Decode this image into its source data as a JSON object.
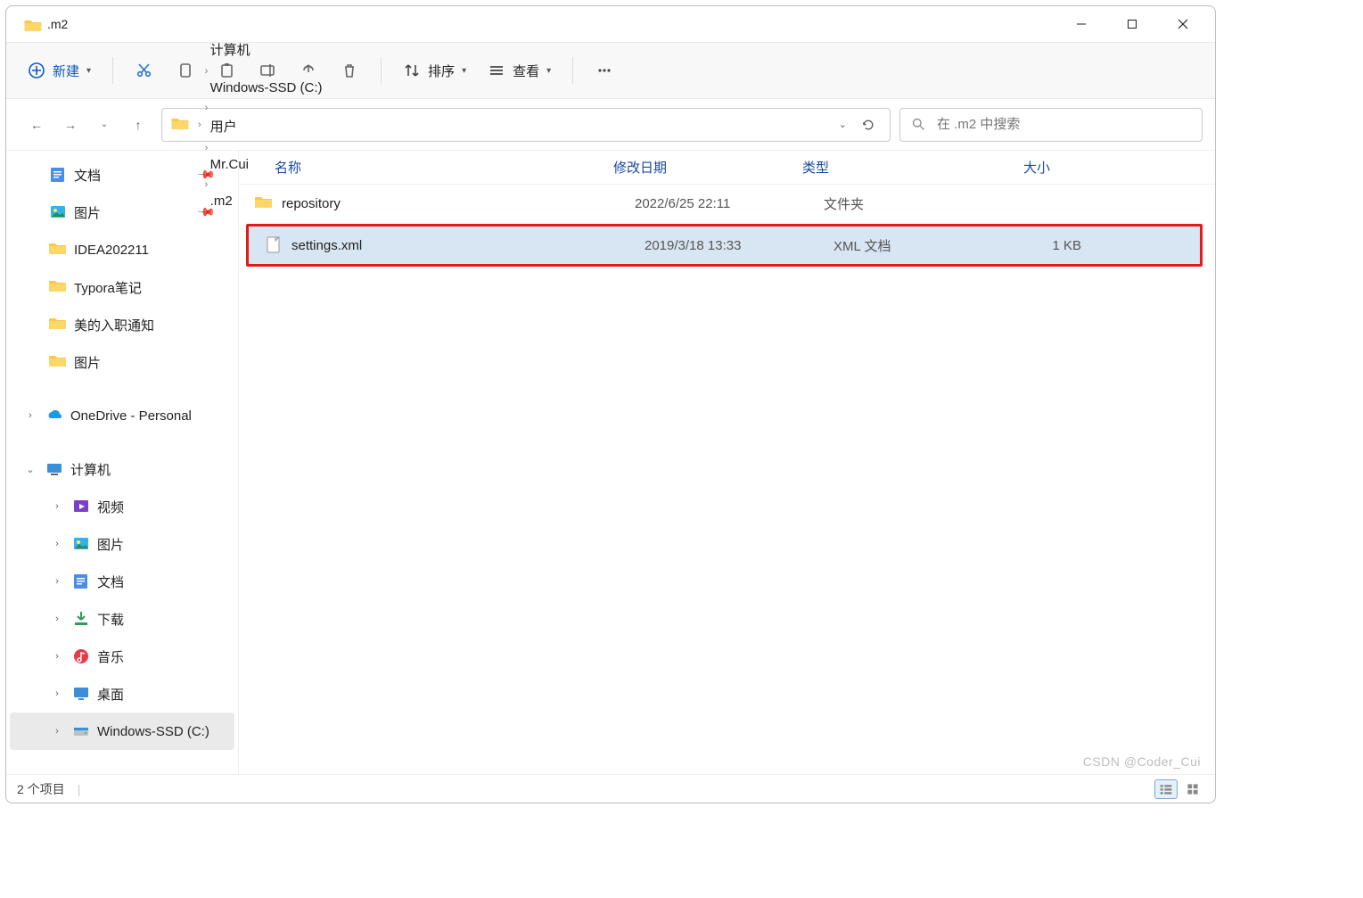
{
  "title": ".m2",
  "toolbar": {
    "new_label": "新建",
    "sort_label": "排序",
    "view_label": "查看"
  },
  "breadcrumb": [
    "计算机",
    "Windows-SSD (C:)",
    "用户",
    "Mr.Cui",
    ".m2"
  ],
  "search": {
    "placeholder": "在 .m2 中搜索"
  },
  "columns": {
    "name": "名称",
    "date": "修改日期",
    "type": "类型",
    "size": "大小"
  },
  "files": [
    {
      "name": "repository",
      "date": "2022/6/25 22:11",
      "type": "文件夹",
      "size": "",
      "icon": "folder"
    },
    {
      "name": "settings.xml",
      "date": "2019/3/18 13:33",
      "type": "XML 文档",
      "size": "1 KB",
      "icon": "file",
      "highlighted": true
    }
  ],
  "sidebar": {
    "quick": [
      {
        "label": "文档",
        "icon": "doc",
        "pinned": true
      },
      {
        "label": "图片",
        "icon": "picture",
        "pinned": true
      },
      {
        "label": "IDEA202211",
        "icon": "folder"
      },
      {
        "label": "Typora笔记",
        "icon": "folder"
      },
      {
        "label": "美的入职通知",
        "icon": "folder"
      },
      {
        "label": "图片",
        "icon": "folder"
      }
    ],
    "onedrive": {
      "label": "OneDrive - Personal"
    },
    "computer": {
      "label": "计算机",
      "children": [
        {
          "label": "视频",
          "icon": "video"
        },
        {
          "label": "图片",
          "icon": "picture"
        },
        {
          "label": "文档",
          "icon": "doc"
        },
        {
          "label": "下载",
          "icon": "download"
        },
        {
          "label": "音乐",
          "icon": "music"
        },
        {
          "label": "桌面",
          "icon": "desktop"
        },
        {
          "label": "Windows-SSD (C:)",
          "icon": "drive",
          "selected": true
        }
      ]
    }
  },
  "status": {
    "items_label": "2 个项目"
  },
  "watermark": "CSDN @Coder_Cui"
}
